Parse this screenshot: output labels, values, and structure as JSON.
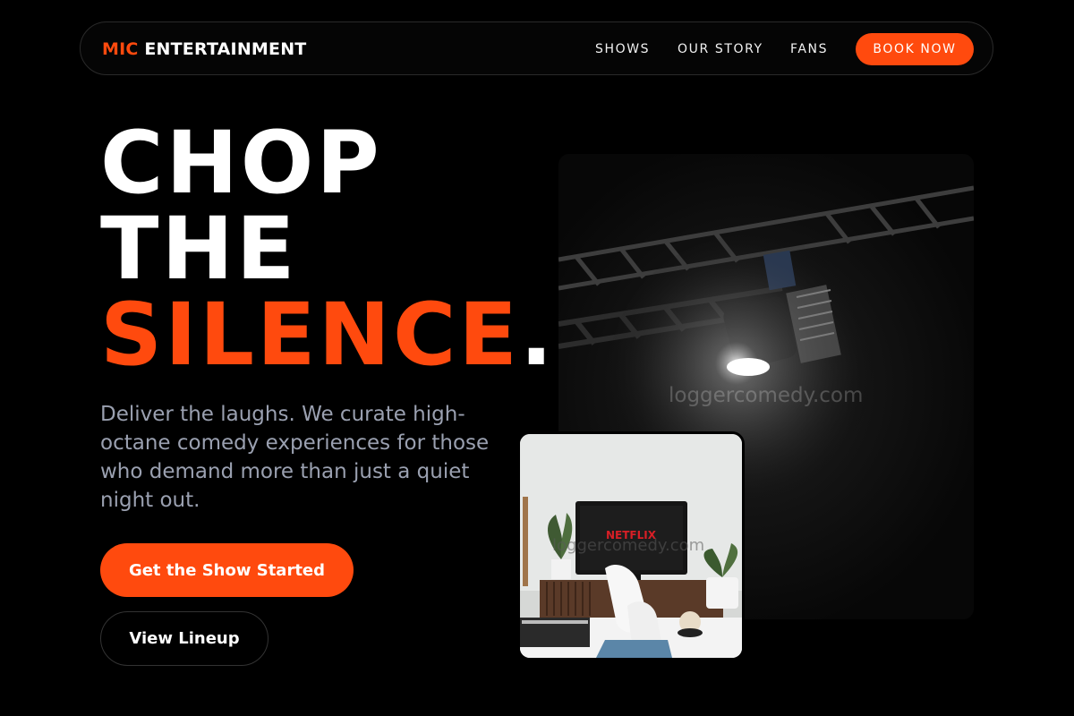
{
  "nav": {
    "brand_accent": "MIC",
    "brand_main": "ENTERTAINMENT",
    "links": [
      "SHOWS",
      "OUR STORY",
      "FANS"
    ],
    "cta": "BOOK NOW"
  },
  "hero": {
    "line1": "CHOP",
    "line2": "THE",
    "line3": "SILENCE",
    "period": ".",
    "description": "Deliver the laughs. We curate high-octane comedy experiences for those who demand more than just a quiet night out.",
    "primary_cta": "Get the Show Started",
    "secondary_cta": "View Lineup"
  },
  "images": {
    "stage_watermark": "loggercomedy.com",
    "tv_watermark": "loggercomedy.com",
    "tv_screen_text": "NETFLIX"
  },
  "colors": {
    "accent": "#ff4a0e",
    "background": "#000000",
    "muted_text": "#9aa0b0"
  }
}
